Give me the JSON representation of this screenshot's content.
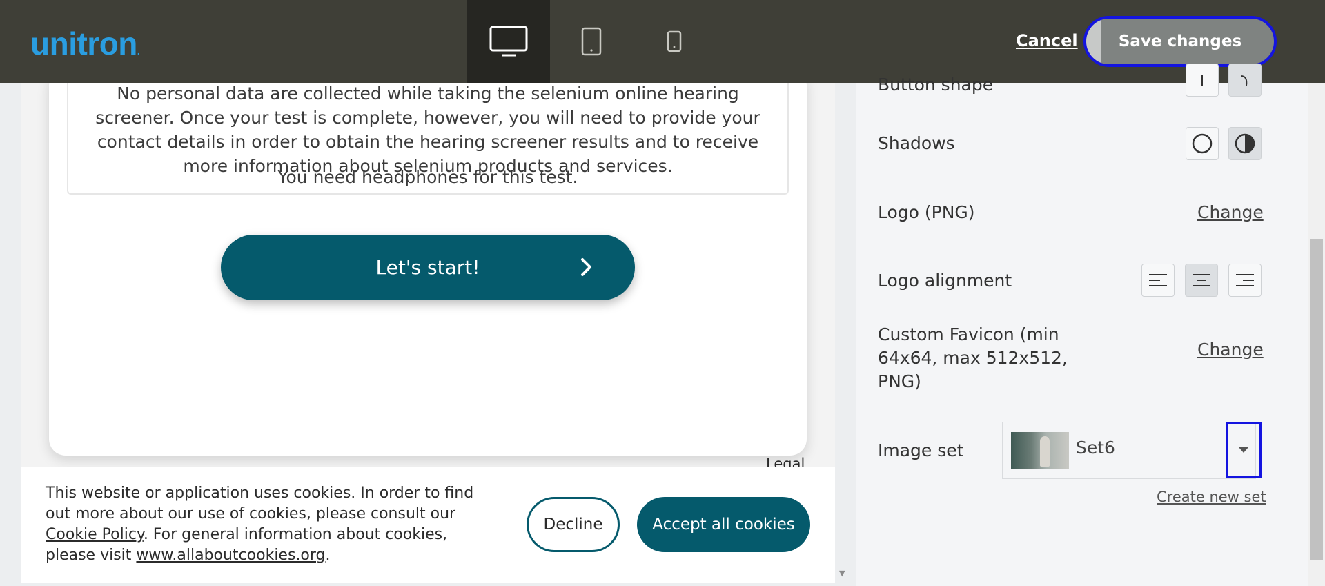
{
  "topbar": {
    "logo": "unitron",
    "logo_mark": ".",
    "cancel_label": "Cancel",
    "save_label": "Save changes",
    "devices": [
      "desktop-icon",
      "tablet-icon",
      "mobile-icon"
    ],
    "active_device": "desktop-icon"
  },
  "preview": {
    "intro_text": "No personal data are collected while taking the selenium online hearing screener. Once your test is complete, however, you will need to provide your contact details in order to obtain the hearing screener results and to receive more information about selenium products and services.",
    "headphones_note": "You need headphones for this test.",
    "start_label": "Let's start!",
    "legal_label": "Legal",
    "cookie": {
      "text_1": "This website or application uses cookies. In order to find out more about our use of cookies, please consult our ",
      "policy_link": "Cookie Policy",
      "text_2": ". For general information about cookies, please visit ",
      "site_link": "www.allaboutcookies.org",
      "text_3": ".",
      "decline_label": "Decline",
      "accept_label": "Accept all cookies"
    }
  },
  "settings": {
    "button_shape_label": "Button shape",
    "shadows_label": "Shadows",
    "logo_label": "Logo (PNG)",
    "logo_change": "Change",
    "logo_alignment_label": "Logo alignment",
    "favicon_label": "Custom Favicon (min 64x64, max 512x512, PNG)",
    "favicon_change": "Change",
    "image_set_label": "Image set",
    "image_set_value": "Set6",
    "create_new_set": "Create new set"
  },
  "colors": {
    "topbar": "#3f3f37",
    "brand_blue": "#2a9de0",
    "teal": "#055a6c",
    "focus": "#1414e0"
  }
}
